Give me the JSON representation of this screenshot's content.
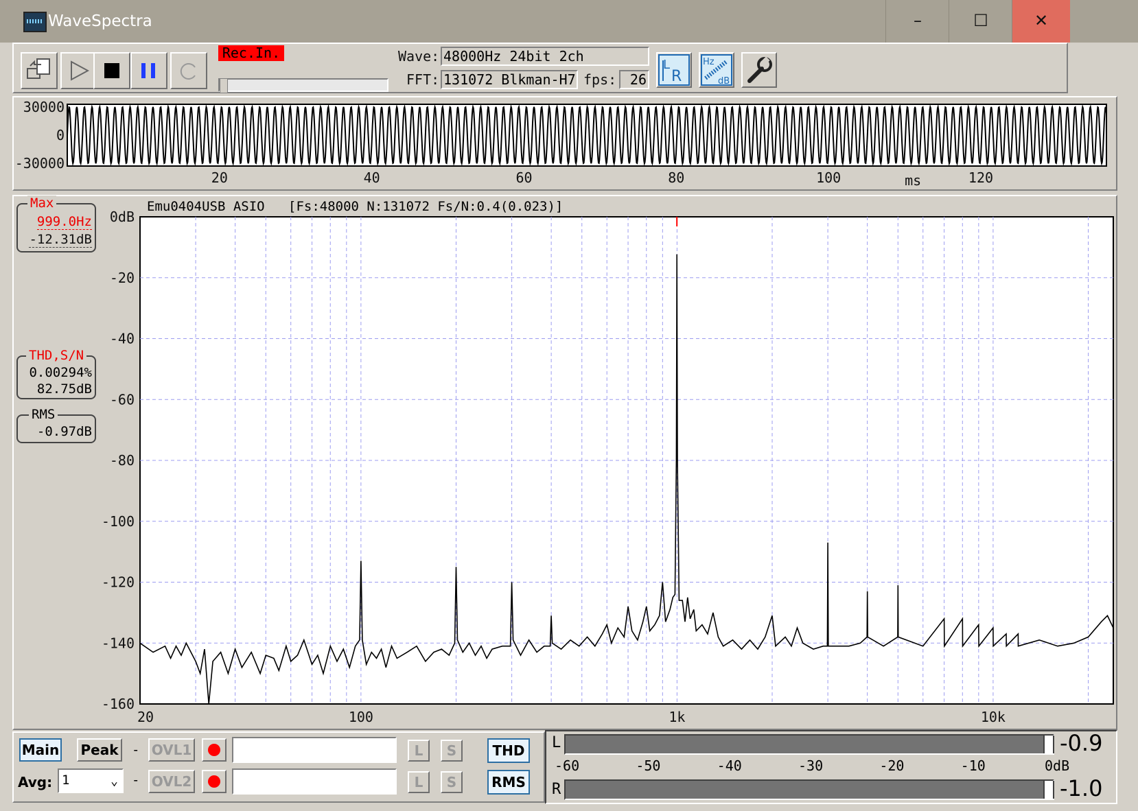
{
  "window": {
    "title": "WaveSpectra",
    "minimize": "–",
    "maximize": "☐",
    "close": "✕",
    "close_bg": "#e06c5e"
  },
  "toolbar": {
    "open_icon": "file-open-icon",
    "play_icon": "play-icon",
    "stop_icon": "stop-icon",
    "pause_icon": "pause-icon",
    "loop_icon": "loop-icon",
    "rec_label": "Rec.In.",
    "rec_color": "#ff0000",
    "wave_label": "Wave:",
    "wave_value": "48000Hz 24bit 2ch",
    "fft_label": "FFT:",
    "fft_value": "131072 Blkman-H7",
    "fps_label": "fps:",
    "fps_value": "26",
    "lr_icon": "lr-channel-icon",
    "hzdb_icon": "hz-db-scale-icon",
    "settings_icon": "wrench-settings-icon"
  },
  "waveform": {
    "y_ticks": [
      "30000",
      "0",
      "-30000"
    ],
    "x_ticks": [
      "20",
      "40",
      "60",
      "80",
      "100",
      "120"
    ],
    "x_unit": "ms",
    "xlim": [
      0,
      136.5
    ],
    "ylim": [
      -32768,
      32767
    ],
    "signal_frequency_hz": 999,
    "amplitude": 30000
  },
  "spectrum": {
    "device_label": "Emu0404USB ASIO",
    "params_label": "[Fs:48000 N:131072 Fs/N:0.4(0.023)]",
    "max_box": {
      "title": "Max",
      "freq": "999.0Hz",
      "level": "-12.31dB"
    },
    "thd_box": {
      "title": "THD,S/N",
      "thd": "0.00294%",
      "sn": "82.75dB"
    },
    "rms_box": {
      "title": "RMS",
      "value": "-0.97dB"
    },
    "marker_color": "#ff0000"
  },
  "chart_data": {
    "type": "line",
    "x_scale": "log",
    "xlim": [
      20,
      24000
    ],
    "ylim": [
      -160,
      0
    ],
    "y_ticks": [
      "0dB",
      "-20",
      "-40",
      "-60",
      "-80",
      "-100",
      "-120",
      "-140",
      "-160"
    ],
    "x_ticks": [
      "20",
      "100",
      "1k",
      "10k"
    ],
    "grid": true,
    "series": [
      {
        "points": [
          [
            20,
            -140
          ],
          [
            22,
            -143
          ],
          [
            24,
            -141
          ],
          [
            25,
            -145
          ],
          [
            26,
            -141
          ],
          [
            27,
            -144
          ],
          [
            28,
            -140
          ],
          [
            30,
            -146
          ],
          [
            31,
            -150
          ],
          [
            32,
            -142
          ],
          [
            33,
            -160
          ],
          [
            34,
            -146
          ],
          [
            36,
            -143
          ],
          [
            38,
            -150
          ],
          [
            40,
            -142
          ],
          [
            42,
            -148
          ],
          [
            45,
            -143
          ],
          [
            48,
            -150
          ],
          [
            50,
            -144
          ],
          [
            53,
            -145
          ],
          [
            55,
            -149
          ],
          [
            58,
            -141
          ],
          [
            60,
            -146
          ],
          [
            63,
            -144
          ],
          [
            66,
            -139
          ],
          [
            70,
            -147
          ],
          [
            73,
            -144
          ],
          [
            76,
            -150
          ],
          [
            80,
            -141
          ],
          [
            84,
            -146
          ],
          [
            88,
            -142
          ],
          [
            92,
            -148
          ],
          [
            96,
            -141
          ],
          [
            99,
            -139
          ],
          [
            100,
            -113
          ],
          [
            101,
            -139
          ],
          [
            104,
            -147
          ],
          [
            108,
            -143
          ],
          [
            112,
            -145
          ],
          [
            116,
            -142
          ],
          [
            120,
            -148
          ],
          [
            125,
            -141
          ],
          [
            130,
            -145
          ],
          [
            140,
            -143
          ],
          [
            150,
            -141
          ],
          [
            160,
            -146
          ],
          [
            170,
            -143
          ],
          [
            180,
            -142
          ],
          [
            190,
            -144
          ],
          [
            198,
            -140
          ],
          [
            200,
            -115
          ],
          [
            202,
            -139
          ],
          [
            210,
            -143
          ],
          [
            220,
            -140
          ],
          [
            230,
            -144
          ],
          [
            240,
            -141
          ],
          [
            250,
            -145
          ],
          [
            260,
            -142
          ],
          [
            280,
            -141
          ],
          [
            297,
            -141
          ],
          [
            300,
            -120
          ],
          [
            303,
            -139
          ],
          [
            320,
            -144
          ],
          [
            340,
            -139
          ],
          [
            360,
            -143
          ],
          [
            380,
            -141
          ],
          [
            397,
            -141
          ],
          [
            400,
            -131
          ],
          [
            403,
            -140
          ],
          [
            430,
            -142
          ],
          [
            460,
            -139
          ],
          [
            490,
            -141
          ],
          [
            520,
            -138
          ],
          [
            550,
            -141
          ],
          [
            580,
            -137
          ],
          [
            600,
            -134
          ],
          [
            620,
            -140
          ],
          [
            650,
            -135
          ],
          [
            680,
            -138
          ],
          [
            700,
            -128
          ],
          [
            720,
            -136
          ],
          [
            750,
            -139
          ],
          [
            780,
            -133
          ],
          [
            800,
            -128
          ],
          [
            820,
            -136
          ],
          [
            850,
            -134
          ],
          [
            880,
            -131
          ],
          [
            900,
            -120
          ],
          [
            920,
            -133
          ],
          [
            950,
            -129
          ],
          [
            970,
            -125
          ],
          [
            985,
            -124
          ],
          [
            995,
            -80
          ],
          [
            999,
            -12.3
          ],
          [
            1003,
            -80
          ],
          [
            1015,
            -126
          ],
          [
            1040,
            -126
          ],
          [
            1060,
            -133
          ],
          [
            1080,
            -125
          ],
          [
            1100,
            -132
          ],
          [
            1130,
            -129
          ],
          [
            1150,
            -136
          ],
          [
            1200,
            -134
          ],
          [
            1250,
            -137
          ],
          [
            1300,
            -130
          ],
          [
            1350,
            -138
          ],
          [
            1400,
            -141
          ],
          [
            1500,
            -139
          ],
          [
            1600,
            -142
          ],
          [
            1700,
            -139
          ],
          [
            1800,
            -142
          ],
          [
            1900,
            -138
          ],
          [
            2000,
            -131
          ],
          [
            2050,
            -141
          ],
          [
            2200,
            -138
          ],
          [
            2300,
            -141
          ],
          [
            2400,
            -135
          ],
          [
            2500,
            -140
          ],
          [
            2700,
            -142
          ],
          [
            2900,
            -141
          ],
          [
            2990,
            -141
          ],
          [
            3000,
            -107
          ],
          [
            3010,
            -141
          ],
          [
            3200,
            -141
          ],
          [
            3500,
            -141
          ],
          [
            3800,
            -140
          ],
          [
            3990,
            -138
          ],
          [
            4000,
            -123
          ],
          [
            4010,
            -138
          ],
          [
            4500,
            -141
          ],
          [
            4990,
            -138
          ],
          [
            5000,
            -121
          ],
          [
            5010,
            -138
          ],
          [
            6000,
            -141
          ],
          [
            7000,
            -132
          ],
          [
            7010,
            -141
          ],
          [
            8000,
            -132
          ],
          [
            8010,
            -141
          ],
          [
            9000,
            -134
          ],
          [
            9010,
            -141
          ],
          [
            10000,
            -135
          ],
          [
            10010,
            -141
          ],
          [
            11000,
            -137
          ],
          [
            11010,
            -141
          ],
          [
            12000,
            -137
          ],
          [
            12010,
            -141
          ],
          [
            14000,
            -139
          ],
          [
            16000,
            -141
          ],
          [
            18000,
            -140
          ],
          [
            20000,
            -138
          ],
          [
            22000,
            -133
          ],
          [
            23000,
            -131
          ],
          [
            24000,
            -135
          ]
        ]
      }
    ]
  },
  "bottom": {
    "main_label": "Main",
    "peak_label": "Peak",
    "dash": "-",
    "ovl1_label": "OVL1",
    "ovl2_label": "OVL2",
    "avg_label": "Avg:",
    "avg_value": "1",
    "l_label": "L",
    "s_label": "S",
    "thd_label": "THD",
    "rms_label": "RMS",
    "rec_dot_color": "#ff0000"
  },
  "meters": {
    "l_label": "L",
    "r_label": "R",
    "l_value": "-0.9",
    "r_value": "-1.0",
    "l_level_db": -0.9,
    "r_level_db": -1.0,
    "scale": [
      "-60",
      "-50",
      "-40",
      "-30",
      "-20",
      "-10",
      "0dB"
    ]
  }
}
